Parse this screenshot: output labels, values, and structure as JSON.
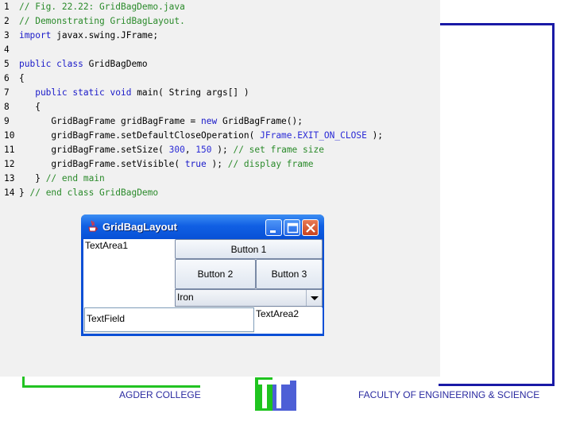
{
  "code": [
    {
      "num": "1",
      "segments": [
        {
          "t": "// Fig. 22.22: GridBagDemo.java",
          "c": "cm"
        }
      ]
    },
    {
      "num": "2",
      "segments": [
        {
          "t": "// Demonstrating GridBagLayout.",
          "c": "cm"
        }
      ]
    },
    {
      "num": "3",
      "segments": [
        {
          "t": "import",
          "c": "kw"
        },
        {
          "t": " javax.swing.JFrame;",
          "c": ""
        }
      ]
    },
    {
      "num": "4",
      "segments": []
    },
    {
      "num": "5",
      "segments": [
        {
          "t": "public class",
          "c": "kw"
        },
        {
          "t": " GridBagDemo",
          "c": ""
        }
      ]
    },
    {
      "num": "6",
      "segments": [
        {
          "t": "{",
          "c": ""
        }
      ]
    },
    {
      "num": "7",
      "segments": [
        {
          "t": "   public static void",
          "c": "kw"
        },
        {
          "t": " main( String args[] )",
          "c": ""
        }
      ]
    },
    {
      "num": "8",
      "segments": [
        {
          "t": "   {",
          "c": ""
        }
      ]
    },
    {
      "num": "9",
      "segments": [
        {
          "t": "      GridBagFrame gridBagFrame = ",
          "c": ""
        },
        {
          "t": "new",
          "c": "kw"
        },
        {
          "t": " GridBagFrame();",
          "c": ""
        }
      ]
    },
    {
      "num": "10",
      "segments": [
        {
          "t": "      gridBagFrame.setDefaultCloseOperation( ",
          "c": ""
        },
        {
          "t": "JFrame.EXIT_ON_CLOSE",
          "c": "cs"
        },
        {
          "t": " );",
          "c": ""
        }
      ]
    },
    {
      "num": "11",
      "segments": [
        {
          "t": "      gridBagFrame.setSize( ",
          "c": ""
        },
        {
          "t": "300",
          "c": "cs"
        },
        {
          "t": ", ",
          "c": ""
        },
        {
          "t": "150",
          "c": "cs"
        },
        {
          "t": " ); ",
          "c": ""
        },
        {
          "t": "// set frame size",
          "c": "cm"
        }
      ]
    },
    {
      "num": "12",
      "segments": [
        {
          "t": "      gridBagFrame.setVisible( ",
          "c": ""
        },
        {
          "t": "true",
          "c": "kw"
        },
        {
          "t": " ); ",
          "c": ""
        },
        {
          "t": "// display frame",
          "c": "cm"
        }
      ]
    },
    {
      "num": "13",
      "segments": [
        {
          "t": "   } ",
          "c": ""
        },
        {
          "t": "// end main",
          "c": "cm"
        }
      ]
    },
    {
      "num": "14",
      "segments": [
        {
          "t": "} ",
          "c": ""
        },
        {
          "t": "// end class GridBagDemo",
          "c": "cm"
        }
      ]
    }
  ],
  "window": {
    "title": "GridBagLayout",
    "icon": "java-coffee-cup-icon",
    "textarea1": "TextArea1",
    "button1": "Button 1",
    "button2": "Button 2",
    "button3": "Button 3",
    "combo_value": "Iron",
    "textarea2": "TextArea2",
    "textfield": "TextField"
  },
  "footer": {
    "left": "AGDER COLLEGE",
    "right": "FACULTY OF ENGINEERING & SCIENCE"
  },
  "colors": {
    "frame_blue": "#1a1aa6",
    "frame_green": "#22c322",
    "title_blue": "#0a4fd6"
  }
}
